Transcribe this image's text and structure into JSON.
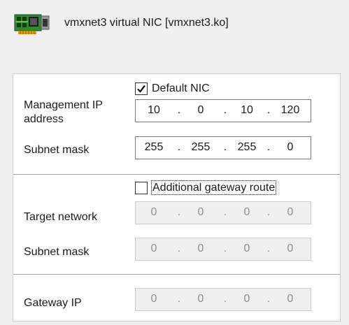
{
  "header": {
    "icon": "network-card-icon",
    "title": "vmxnet3 virtual NIC [vmxnet3.ko]"
  },
  "default_section": {
    "default_nic": {
      "label": "Default NIC",
      "checked": true
    },
    "management_ip": {
      "label_line1": "Management IP",
      "label_line2": "address",
      "octets": [
        "10",
        "0",
        "10",
        "120"
      ]
    },
    "subnet_mask": {
      "label": "Subnet mask",
      "octets": [
        "255",
        "255",
        "255",
        "0"
      ]
    }
  },
  "gateway_route_section": {
    "additional_gateway_route": {
      "label": "Additional gateway route",
      "checked": false
    },
    "target_network": {
      "label": "Target network",
      "octets": [
        "0",
        "0",
        "0",
        "0"
      ]
    },
    "subnet_mask": {
      "label": "Subnet mask",
      "octets": [
        "0",
        "0",
        "0",
        "0"
      ]
    }
  },
  "gateway_section": {
    "gateway_ip": {
      "label": "Gateway IP",
      "octets": [
        "0",
        "0",
        "0",
        "0"
      ]
    }
  },
  "ip_separator": "."
}
